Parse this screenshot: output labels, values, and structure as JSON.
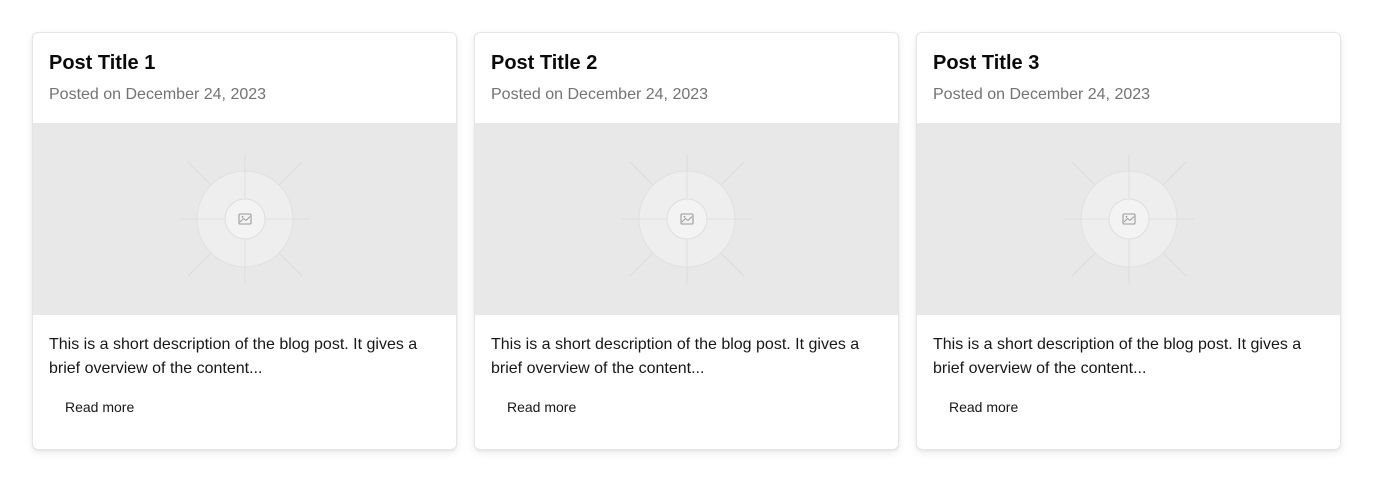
{
  "posts": [
    {
      "title": "Post Title 1",
      "date": "Posted on December 24, 2023",
      "description": "This is a short description of the blog post. It gives a brief overview of the content...",
      "read_more_label": "Read more",
      "image_icon": "image-placeholder-icon"
    },
    {
      "title": "Post Title 2",
      "date": "Posted on December 24, 2023",
      "description": "This is a short description of the blog post. It gives a brief overview of the content...",
      "read_more_label": "Read more",
      "image_icon": "image-placeholder-icon"
    },
    {
      "title": "Post Title 3",
      "date": "Posted on December 24, 2023",
      "description": "This is a short description of the blog post. It gives a brief overview of the content...",
      "read_more_label": "Read more",
      "image_icon": "image-placeholder-icon"
    }
  ],
  "colors": {
    "image_placeholder_bg": "#e8e8e8",
    "muted_text": "#737373",
    "card_border": "#e5e5e5"
  }
}
